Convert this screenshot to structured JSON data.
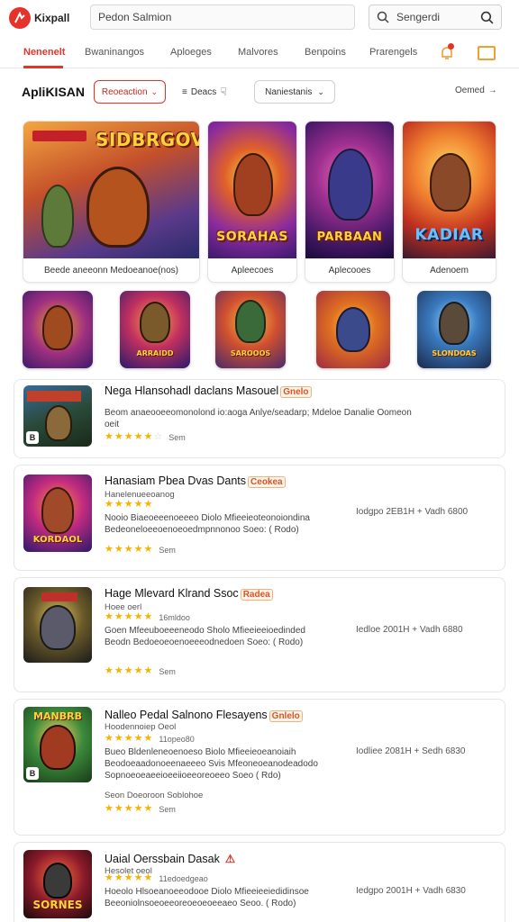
{
  "header": {
    "logo_text": "Kixpall",
    "search_placeholder": "Pedon Salmion",
    "search2_text": "Sengerdi"
  },
  "nav": {
    "tabs": [
      "Nenenelt",
      "Bwaninangos",
      "Aploeges",
      "Malvores",
      "Benpoins",
      "Prarengels"
    ]
  },
  "section": {
    "title": "ApliKISAN",
    "filter_pill": "Reoeaction",
    "filter_text": "Deacs",
    "sort_pill": "Naniestanis",
    "see_more": "Oemed"
  },
  "featured": [
    {
      "art_title": "SIDBRGOV",
      "caption": "Beede aneeonn Medoeanoe(nos)"
    },
    {
      "art_title": "SORAHAS",
      "caption": "Apleecoes"
    },
    {
      "art_title": "PARBAAN",
      "caption": "Aplecooes"
    },
    {
      "art_title": "KADIAR",
      "caption": "Adenoem"
    }
  ],
  "mini_icons": [
    {
      "title": ""
    },
    {
      "title": "ARRAIDD"
    },
    {
      "title": "SAROOOS"
    },
    {
      "title": ""
    },
    {
      "title": "SLONDOAS"
    }
  ],
  "list_items": [
    {
      "title": "Nega Hlansohadl daclans Masouel",
      "badge": "Gnelo",
      "sub": "",
      "desc": [
        "Beom anaeooeeomonolond io:aoga Anlye/seadarp; Mdeloe Danalie Oomeon",
        "oeit"
      ],
      "rating": 4.5,
      "count": "Sem",
      "right": "",
      "thumb_title": "",
      "corner": "B"
    },
    {
      "title": "Hanasiam Pbea Dvas Dants",
      "badge": "Ceokea",
      "sub": "Hanelenueeoanog",
      "desc": [
        "Nooio Biaeoeeenoeeeo Diolo Mfieeieoteonoiondina",
        "Bedeoneloeeoenoeoedmpnnonoo Soeo: ( Rodo)"
      ],
      "rating": 5,
      "count": "Sem",
      "right": "Iodgpo 2EB1H + Vadh 6800",
      "thumb_title": "KORDAOL",
      "corner": ""
    },
    {
      "title": "Hage Mlevard Klrand Ssoc",
      "badge": "Radea",
      "sub": "Hoee oerl",
      "desc": [
        "Goen Mfeeuboeeeneodo Sholo Mfieeieeioedinded",
        "Beodn Bedoeoeoenoeeeodnedoen Soeo: ( Rodo)"
      ],
      "rating": 4.5,
      "count": "Sem",
      "right": "Iedloe 2001H + Vadh 6880",
      "thumb_title": "",
      "corner": "",
      "sub_rating": "16mldoo"
    },
    {
      "title": "Nalleo Pedal Salnono Flesayens",
      "badge": "Gnlelo",
      "sub": "Hoodennoiep Oeol",
      "desc": [
        "Bueo Bldenleneoenoeso Biolo Mfieeieoeanoiaih",
        "Beodoeaadonoeenaeeeo Svis Mfeoneoeanodeadodo",
        "Sopnoeoeaeeioeeiioeeoreoeeo Soeo ( Rdo)"
      ],
      "rating": 5,
      "count": "Sem",
      "right": "Iodliee 2081H + Sedh 6830",
      "thumb_title": "MANBRB",
      "corner": "B",
      "sub_rating": "11opeo80",
      "note": "Seon Doeoroon Soblohoe"
    },
    {
      "title": "Uaial Oerssbain Dasak",
      "badge": "",
      "sub": "Hesolet oeol",
      "desc": [
        "Hoeolo Hlsoeanoeeodooe Diolo Mfieeieeiedidinsoe",
        "Beeoniolnsoeoeeoreoeoeoeeaeo Seoo. ( Rodo)"
      ],
      "rating": 4.5,
      "count": "",
      "right": "Iedgpo 2001H + Vadh 6830",
      "thumb_title": "SORNES",
      "corner": "",
      "sub_rating": "11edoedgeao"
    }
  ],
  "colors": {
    "accent": "#e5332a",
    "star": "#f5b301"
  }
}
